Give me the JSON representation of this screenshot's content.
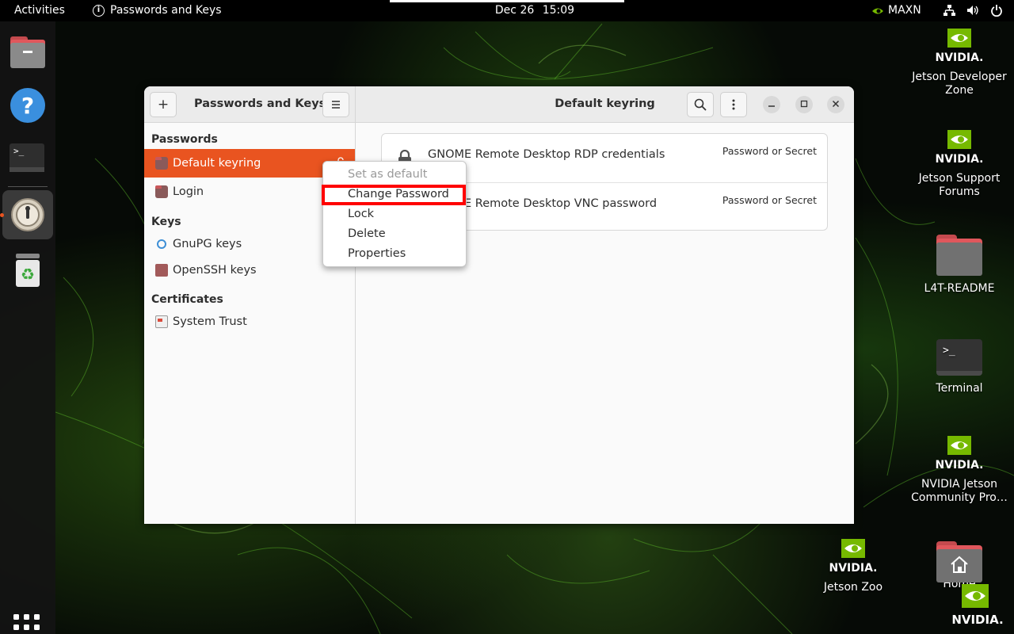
{
  "topbar": {
    "activities": "Activities",
    "app_name": "Passwords and Keys",
    "date": "Dec 26",
    "time": "15:09",
    "power_mode": "MAXN"
  },
  "desktop_icons": [
    {
      "label": "Jetson Developer Zone",
      "kind": "nvidia"
    },
    {
      "label": "Jetson Support Forums",
      "kind": "nvidia"
    },
    {
      "label": "L4T-README",
      "kind": "folder"
    },
    {
      "label": "Terminal",
      "kind": "terminal"
    },
    {
      "label": "NVIDIA Jetson Community Pro…",
      "kind": "nvidia"
    },
    {
      "label": "Jetson Zoo",
      "kind": "nvidia"
    },
    {
      "label": "Home",
      "kind": "home"
    }
  ],
  "nvidia_wordmark": "NVIDIA.",
  "window": {
    "sidebar_title": "Passwords and Keys",
    "content_title": "Default keyring",
    "sections": {
      "passwords": "Passwords",
      "keys": "Keys",
      "certificates": "Certificates"
    },
    "sidebar_items": {
      "default_keyring": "Default keyring",
      "login": "Login",
      "gnupg": "GnuPG keys",
      "openssh": "OpenSSH keys",
      "system_trust": "System Trust"
    },
    "items": [
      {
        "name": "GNOME Remote Desktop RDP credentials",
        "kind": "Password or Secret"
      },
      {
        "name": "GNOME Remote Desktop VNC password",
        "kind": "Password or Secret"
      }
    ]
  },
  "context_menu": {
    "set_default": "Set as default",
    "change_password": "Change Password",
    "lock": "Lock",
    "delete": "Delete",
    "properties": "Properties"
  },
  "colors": {
    "accent": "#e95420",
    "highlight": "#ff0000",
    "nvidia_green": "#76b900"
  }
}
